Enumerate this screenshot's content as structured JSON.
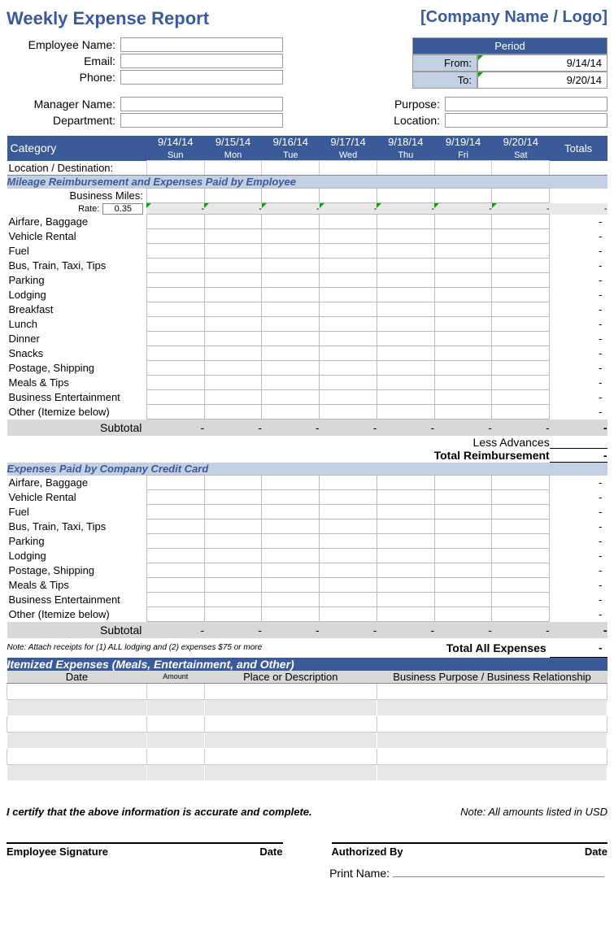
{
  "header": {
    "title": "Weekly Expense Report",
    "company": "[Company Name / Logo]"
  },
  "employee": {
    "name_label": "Employee Name:",
    "email_label": "Email:",
    "phone_label": "Phone:",
    "manager_label": "Manager Name:",
    "department_label": "Department:",
    "purpose_label": "Purpose:",
    "location_label": "Location:"
  },
  "period": {
    "header": "Period",
    "from_label": "From:",
    "to_label": "To:",
    "from_value": "9/14/14",
    "to_value": "9/20/14"
  },
  "columns": {
    "category": "Category",
    "totals": "Totals",
    "days": [
      {
        "date": "9/14/14",
        "day": "Sun"
      },
      {
        "date": "9/15/14",
        "day": "Mon"
      },
      {
        "date": "9/16/14",
        "day": "Tue"
      },
      {
        "date": "9/17/14",
        "day": "Wed"
      },
      {
        "date": "9/18/14",
        "day": "Thu"
      },
      {
        "date": "9/19/14",
        "day": "Fri"
      },
      {
        "date": "9/20/14",
        "day": "Sat"
      }
    ]
  },
  "location_row": "Location / Destination:",
  "section1": {
    "title": "Mileage Reimbursement and Expenses Paid by Employee",
    "business_miles": "Business Miles:",
    "rate_label": "Rate:",
    "rate_value": "0.35",
    "rows": [
      "Airfare, Baggage",
      "Vehicle Rental",
      "Fuel",
      "Bus, Train, Taxi, Tips",
      "Parking",
      "Lodging",
      "Breakfast",
      "Lunch",
      "Dinner",
      "Snacks",
      "Postage, Shipping",
      "Meals & Tips",
      "Business Entertainment",
      "Other (Itemize below)"
    ],
    "subtotal": "Subtotal",
    "less_advances": "Less Advances",
    "total_reimbursement": "Total Reimbursement"
  },
  "section2": {
    "title": "Expenses Paid by Company Credit Card",
    "rows": [
      "Airfare, Baggage",
      "Vehicle Rental",
      "Fuel",
      "Bus, Train, Taxi, Tips",
      "Parking",
      "Lodging",
      "Postage, Shipping",
      "Meals & Tips",
      "Business Entertainment",
      "Other (Itemize below)"
    ],
    "subtotal": "Subtotal",
    "note": "Note:  Attach receipts for (1) ALL lodging and (2) expenses $75 or more",
    "total_all": "Total All Expenses"
  },
  "itemized": {
    "title": "Itemized Expenses (Meals, Entertainment, and Other)",
    "col_date": "Date",
    "col_amount": "Amount",
    "col_place": "Place or Description",
    "col_purpose": "Business Purpose / Business Relationship"
  },
  "footer": {
    "certify": "I certify that the above information is accurate and complete.",
    "note_usd": "Note: All amounts listed in USD",
    "emp_sig": "Employee Signature",
    "date": "Date",
    "auth_by": "Authorized By",
    "print_name": "Print Name:"
  },
  "dash": "-"
}
